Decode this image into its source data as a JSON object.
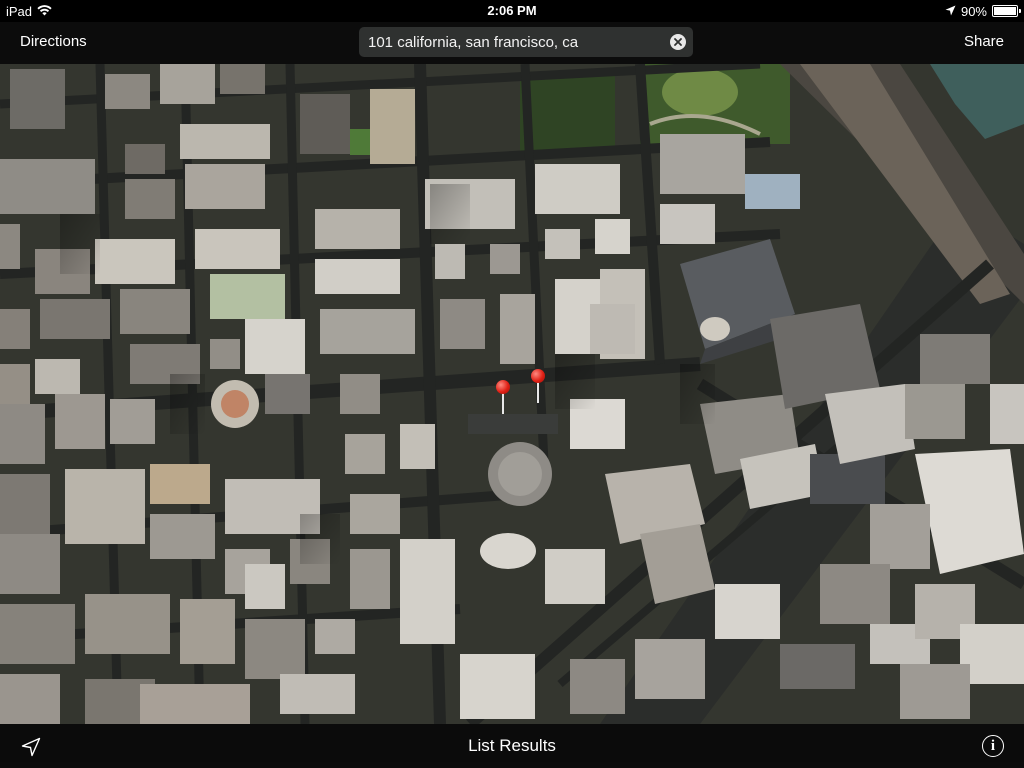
{
  "status_bar": {
    "device": "iPad",
    "time": "2:06 PM",
    "battery": "90%",
    "battery_level": 0.9,
    "icons": [
      "wifi-icon",
      "location-arrow-icon",
      "battery-icon"
    ]
  },
  "toolbar": {
    "directions_label": "Directions",
    "share_label": "Share",
    "search": {
      "value": "101 california, san francisco, ca",
      "placeholder": "Search or Address"
    }
  },
  "map": {
    "view": "satellite",
    "pin_count": 2
  },
  "bottom_bar": {
    "list_results_label": "List Results",
    "icons": [
      "location-arrow-icon",
      "info-icon"
    ]
  },
  "colors": {
    "bar_background": "#0a0a0a",
    "pin_red": "#e02015",
    "text": "#ffffff"
  }
}
